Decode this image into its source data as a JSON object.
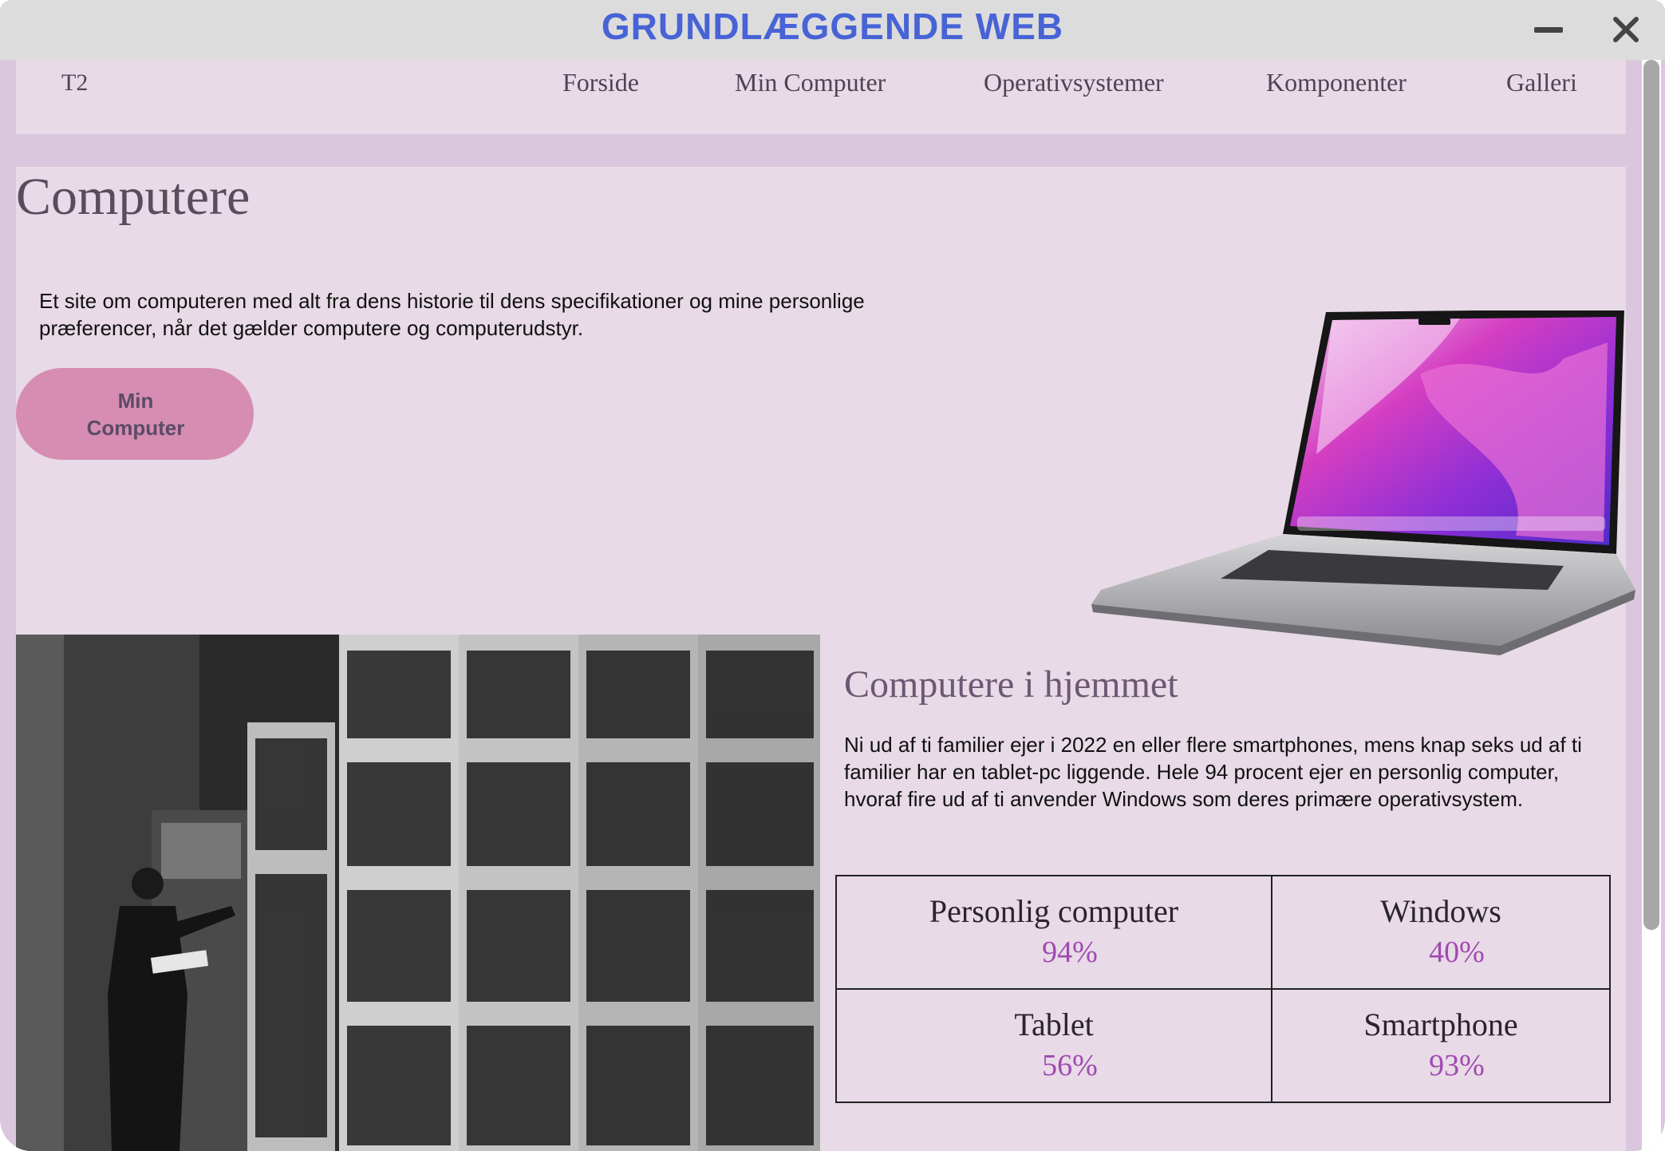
{
  "window": {
    "title": "GRUNDLÆGGENDE WEB"
  },
  "nav": {
    "brand": "T2",
    "items": [
      {
        "label": "Forside"
      },
      {
        "label": "Min Computer"
      },
      {
        "label": "Operativsystemer"
      },
      {
        "label": "Komponenter"
      },
      {
        "label": "Galleri"
      }
    ]
  },
  "hero": {
    "title": "Computere",
    "intro": "Et site om computeren med alt fra dens historie til dens specifikationer og mine personlige præferencer, når det gælder computere og computerudstyr.",
    "button_line1": "Min",
    "button_line2": "Computer"
  },
  "home": {
    "title": "Computere i hjemmet",
    "text": "Ni ud af ti familier ejer i 2022 en eller flere smartphones, mens knap seks ud af ti familier har en tablet-pc liggende. Hele 94 procent ejer en personlig computer, hvoraf fire ud af ti anvender Windows som deres primære operativsystem.",
    "stats": [
      {
        "label": "Personlig computer",
        "value": "94%"
      },
      {
        "label": "Windows",
        "value": "40%"
      },
      {
        "label": "Tablet",
        "value": "56%"
      },
      {
        "label": "Smartphone",
        "value": "93%"
      }
    ]
  },
  "colors": {
    "title_blue": "#4763d6",
    "page_bg": "#dac6dd",
    "panel_bg": "#e8dae6",
    "button_pink": "#d68db1",
    "stat_purple": "#a04ab1"
  }
}
